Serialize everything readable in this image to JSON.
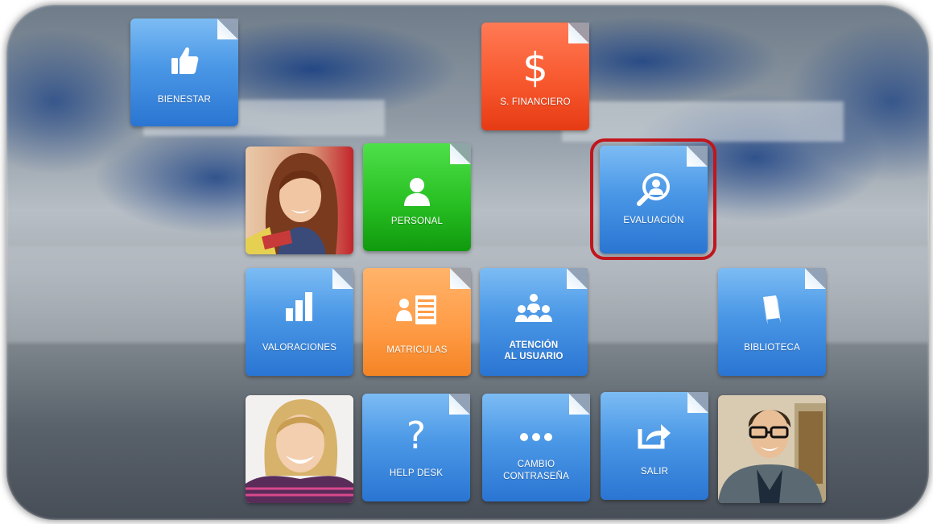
{
  "tiles": {
    "bienestar": {
      "label": "BIENESTAR",
      "icon": "thumbs-up-icon"
    },
    "financiero": {
      "label": "S. FINANCIERO",
      "icon": "dollar-icon",
      "glyph": "$"
    },
    "personal": {
      "label": "PERSONAL",
      "icon": "user-icon"
    },
    "evaluacion": {
      "label": "EVALUACIÓN",
      "icon": "magnifier-person-icon"
    },
    "valoraciones": {
      "label": "VALORACIONES",
      "icon": "bar-chart-icon"
    },
    "matriculas": {
      "label": "MATRICULAS",
      "icon": "person-list-icon"
    },
    "atencion": {
      "label_line1": "ATENCIÓN",
      "label_line2": "AL USUARIO",
      "icon": "group-icon"
    },
    "biblioteca": {
      "label": "BIBLIOTECA",
      "icon": "book-icon"
    },
    "helpdesk": {
      "label": "HELP DESK",
      "icon": "question-mark-icon",
      "glyph": "?"
    },
    "cambio": {
      "label_line1": "CAMBIO",
      "label_line2": "CONTRASEÑA",
      "icon": "ellipsis-icon"
    },
    "salir": {
      "label": "SALIR",
      "icon": "share-exit-icon"
    }
  },
  "colors": {
    "blue": "#4a97e6",
    "orange": "#f8582e",
    "green": "#28c023",
    "light_orange": "#ff9c47",
    "highlight": "#c0161c"
  }
}
